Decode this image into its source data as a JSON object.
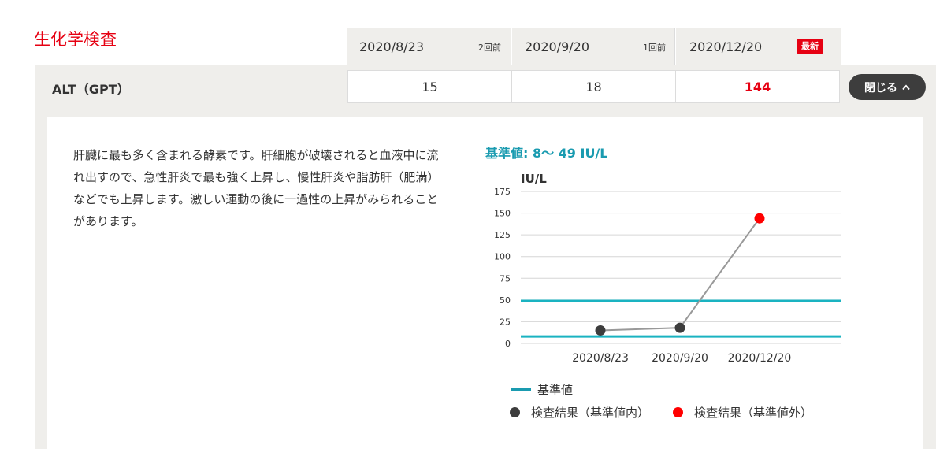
{
  "section": {
    "title": "生化学検査"
  },
  "dates": [
    {
      "date": "2020/8/23",
      "tag": "2回前"
    },
    {
      "date": "2020/9/20",
      "tag": "1回前"
    },
    {
      "date": "2020/12/20",
      "badge": "最新"
    }
  ],
  "row": {
    "label": "ALT（GPT）",
    "values": [
      "15",
      "18",
      "144"
    ],
    "close_label": "閉じる",
    "close_icon": "chevron-up-icon"
  },
  "detail": {
    "description": "肝臓に最も多く含まれる酵素です。肝細胞が破壊されると血液中に流れ出すので、急性肝炎で最も強く上昇し、慢性肝炎や脂肪肝（肥満）などでも上昇します。激しい運動の後に一過性の上昇がみられることがあります。",
    "reference": "基準値: 8〜 49 IU/L"
  },
  "colors": {
    "accent_red": "#e60012",
    "reference_line": "#1ab3c1",
    "normal_point": "#3d3d3d",
    "abnormal_point": "#ff0000",
    "band_bg": "#efeeeb"
  },
  "chart_data": {
    "type": "line",
    "ylabel": "IU/L",
    "ylim": [
      0,
      175
    ],
    "yticks": [
      0,
      25,
      50,
      75,
      100,
      125,
      150,
      175
    ],
    "categories": [
      "2020/8/23",
      "2020/9/20",
      "2020/12/20"
    ],
    "series": [
      {
        "name": "検査結果",
        "values": [
          15,
          18,
          144
        ],
        "out_of_range": [
          false,
          false,
          true
        ]
      }
    ],
    "reference_range": [
      8,
      49
    ],
    "grid": true,
    "legend": [
      {
        "label": "基準値",
        "kind": "line"
      },
      {
        "label": "検査結果（基準値内）",
        "kind": "dot-normal"
      },
      {
        "label": "検査結果（基準値外）",
        "kind": "dot-abnormal"
      }
    ],
    "legend_position": "bottom"
  }
}
